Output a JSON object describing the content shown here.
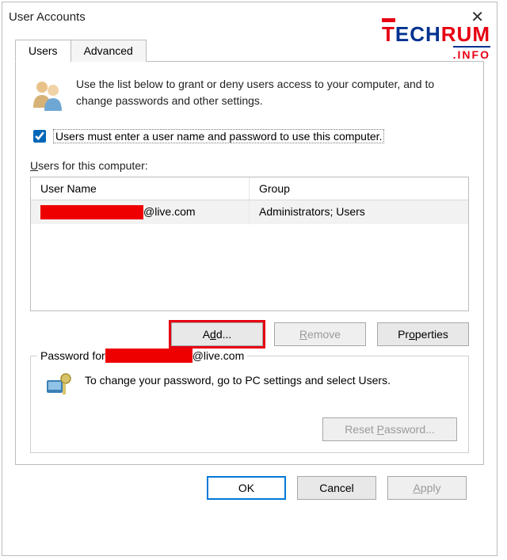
{
  "window": {
    "title": "User Accounts"
  },
  "logo": {
    "part1": "T",
    "part2": "ECH",
    "part3": "RUM",
    "sub": ".INFO"
  },
  "tabs": {
    "users": "Users",
    "advanced": "Advanced"
  },
  "intro": "Use the list below to grant or deny users access to your computer, and to change passwords and other settings.",
  "checkbox": {
    "checked": true,
    "label_pre": "Users must enter a user name and password to use this computer",
    "accel": "."
  },
  "list": {
    "label_pre": "U",
    "label_rest": "sers for this computer:",
    "headers": {
      "user": "User Name",
      "group": "Group"
    },
    "rows": [
      {
        "user_redacted": true,
        "user_suffix": "@live.com",
        "group": "Administrators; Users"
      }
    ]
  },
  "buttons": {
    "add_pre": "A",
    "add_accel": "d",
    "add_post": "d...",
    "remove_accel": "R",
    "remove_rest": "emove",
    "properties_pre": "Pr",
    "properties_accel": "o",
    "properties_post": "perties"
  },
  "password_group": {
    "title_prefix": "Password for ",
    "title_suffix": "@live.com",
    "text": "To change your password, go to PC settings and select Users.",
    "reset_pre": "Reset ",
    "reset_accel": "P",
    "reset_post": "assword..."
  },
  "dialog_buttons": {
    "ok": "OK",
    "cancel": "Cancel",
    "apply_accel": "A",
    "apply_rest": "pply"
  }
}
